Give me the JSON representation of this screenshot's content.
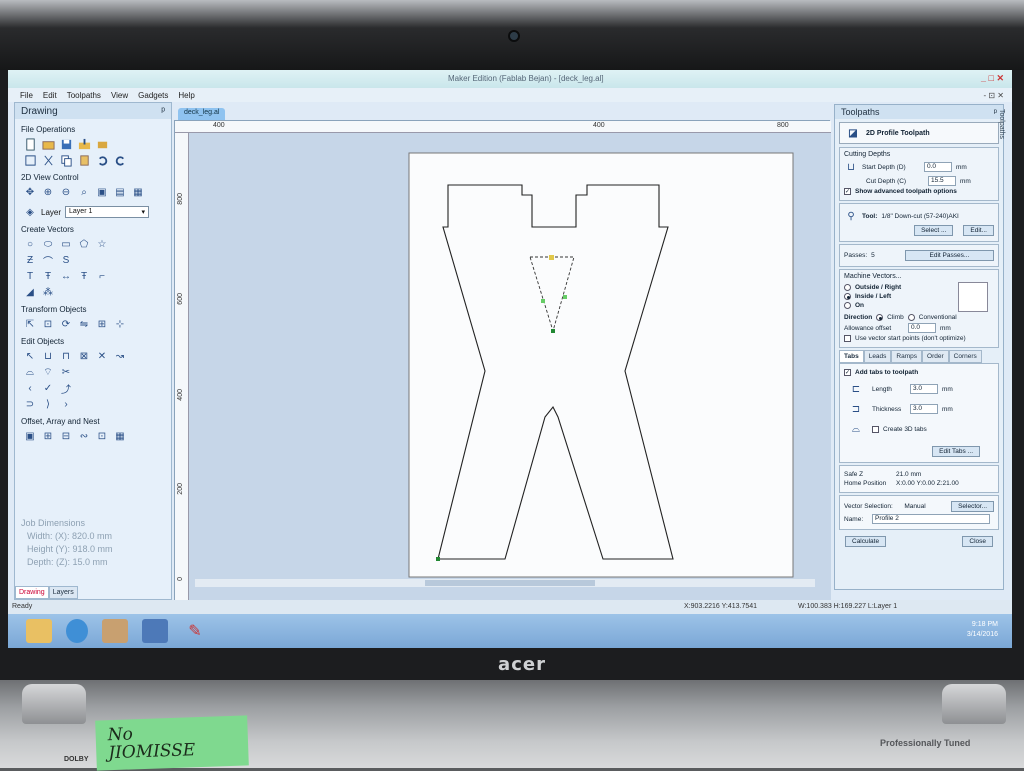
{
  "window": {
    "title": "Maker Edition (Fablab Bejan) - [deck_leg.al]",
    "controls": "_ □ ✕"
  },
  "menu": [
    "File",
    "Edit",
    "Toolpaths",
    "View",
    "Gadgets",
    "Help"
  ],
  "menu_right": "- ⊡ ✕",
  "left_panel": {
    "title": "Drawing",
    "pin": "ᵖ",
    "sections": {
      "file_operations": "File Operations",
      "view_control": "2D View Control",
      "create_vectors": "Create Vectors",
      "transform_objects": "Transform Objects",
      "edit_objects": "Edit Objects",
      "offset": "Offset, Array and Nest"
    },
    "layer_label": "Layer",
    "layer_value": "Layer 1",
    "job_dimensions": {
      "title": "Job Dimensions",
      "width": "Width: (X): 820.0 mm",
      "height": "Height (Y): 918.0 mm",
      "depth": "Depth: (Z): 15.0 mm"
    },
    "tabs": [
      "Drawing",
      "Layers"
    ]
  },
  "document_tab": "deck_leg.al",
  "rulers": {
    "top": [
      "400",
      "400",
      "800"
    ],
    "left": [
      "800",
      "600",
      "400",
      "200",
      "0"
    ]
  },
  "toolpaths_panel": {
    "title": "Toolpaths",
    "side_tab": "Toolpaths",
    "toolpath_type": "2D Profile Toolpath",
    "cutting_depths": "Cutting Depths",
    "start_depth_label": "Start Depth (D)",
    "start_depth_value": "0.0",
    "cut_depth_label": "Cut Depth (C)",
    "cut_depth_value": "15.5",
    "unit": "mm",
    "show_advanced": "Show advanced toolpath options",
    "tool_label": "Tool:",
    "tool_value": "1/8\" Down-cut (57-240)AKI",
    "select_btn": "Select ...",
    "edit_btn": "Edit...",
    "passes_label": "Passes:",
    "passes_value": "5",
    "edit_passes_btn": "Edit Passes...",
    "machine_vectors": "Machine Vectors...",
    "outside": "Outside / Right",
    "inside": "Inside / Left",
    "on": "On",
    "direction_label": "Direction",
    "climb": "Climb",
    "conventional": "Conventional",
    "allowance_label": "Allowance offset",
    "allowance_value": "0.0",
    "use_start_points": "Use vector start points (don't optimize)",
    "tabs": [
      "Tabs",
      "Leads",
      "Ramps",
      "Order",
      "Corners"
    ],
    "add_tabs": "Add tabs to toolpath",
    "length_label": "Length",
    "length_value": "3.0",
    "thickness_label": "Thickness",
    "thickness_value": "3.0",
    "create_3d_tabs": "Create 3D tabs",
    "edit_tabs_btn": "Edit Tabs ...",
    "safe_z_label": "Safe Z",
    "safe_z_value": "21.0 mm",
    "home_label": "Home Position",
    "home_value": "X:0.00 Y:0.00 Z:21.00",
    "vector_selection_label": "Vector Selection:",
    "vector_selection_value": "Manual",
    "selector_btn": "Selector...",
    "name_label": "Name:",
    "name_value": "Profile 2",
    "calculate_btn": "Calculate",
    "close_btn": "Close"
  },
  "status": {
    "ready": "Ready",
    "coords": "X:903.2216 Y:413.7541",
    "size": "W:100.383  H:169.227  L:Layer 1"
  },
  "taskbar": {
    "time": "9:18 PM",
    "date": "3/14/2016"
  },
  "bezel": {
    "brand": "acer",
    "sticker": "No\nJIOMISSE",
    "tuned": "Professionally Tuned",
    "dolby": "DOLBY"
  }
}
